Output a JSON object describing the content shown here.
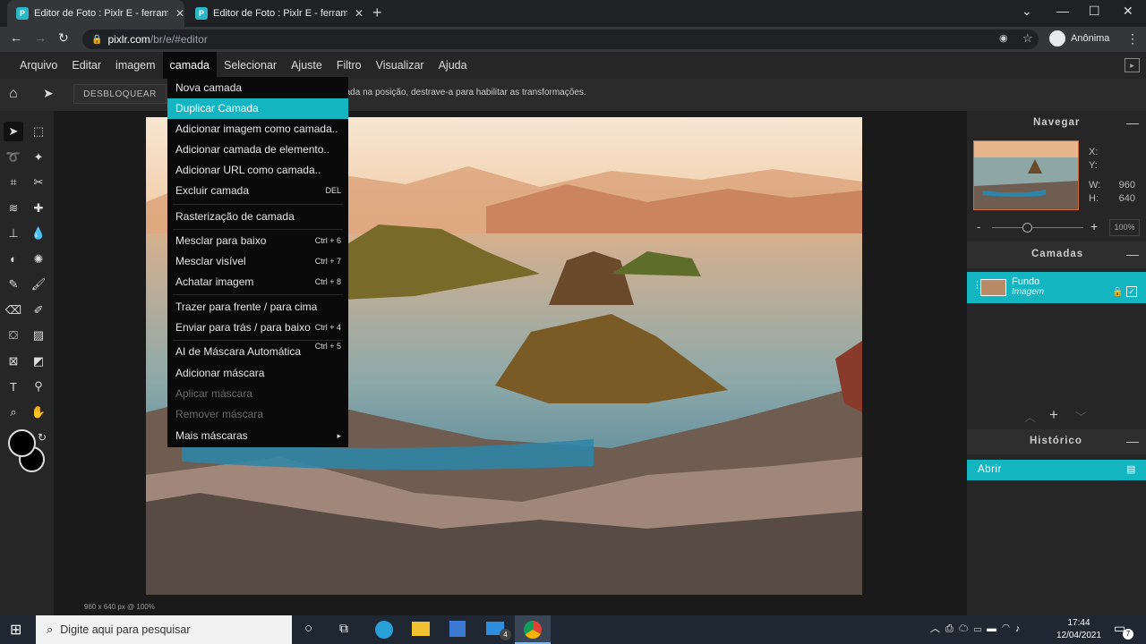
{
  "browser": {
    "tabs": [
      {
        "title": "Editor de Foto : Pixlr E - ferramen",
        "active": true
      },
      {
        "title": "Editor de Foto : Pixlr E - ferramen",
        "active": false
      }
    ],
    "url_host": "pixlr.com",
    "url_path": "/br/e/#editor",
    "profile_label": "Anônima"
  },
  "menubar": {
    "items": [
      "Arquivo",
      "Editar",
      "imagem",
      "camada",
      "Selecionar",
      "Ajuste",
      "Filtro",
      "Visualizar",
      "Ajuda"
    ],
    "active": "camada"
  },
  "toolbar": {
    "unlock_label": "DESBLOQUEAR",
    "info_text": "A camada está travada na posição, destrave-a para habilitar as transformações."
  },
  "dropdown": {
    "items": [
      {
        "label": "Nova camada",
        "shortcut": ""
      },
      {
        "label": "Duplicar Camada",
        "shortcut": "",
        "highlighted": true
      },
      {
        "label": "Adicionar imagem como camada..",
        "shortcut": ""
      },
      {
        "label": "Adicionar camada de elemento..",
        "shortcut": ""
      },
      {
        "label": "Adicionar URL como camada..",
        "shortcut": ""
      },
      {
        "label": "Excluir camada",
        "shortcut": "DEL"
      },
      {
        "label": "Rasterização de camada",
        "shortcut": ""
      },
      {
        "label": "Mesclar para baixo",
        "shortcut": "Ctrl + 6"
      },
      {
        "label": "Mesclar visível",
        "shortcut": "Ctrl + 7"
      },
      {
        "label": "Achatar imagem",
        "shortcut": "Ctrl + 8"
      },
      {
        "label": "Trazer para frente / para cima",
        "shortcut": ""
      },
      {
        "label": "Enviar para trás / para baixo",
        "shortcut": "Ctrl + 4"
      },
      {
        "label": "AI de Máscara Automática",
        "shortcut": "Ctrl + 5"
      },
      {
        "label": "Adicionar máscara",
        "shortcut": ""
      },
      {
        "label": "Aplicar máscara",
        "shortcut": "",
        "disabled": true
      },
      {
        "label": "Remover máscara",
        "shortcut": "",
        "disabled": true
      },
      {
        "label": "Mais máscaras",
        "shortcut": "▸"
      }
    ]
  },
  "navigator": {
    "title": "Navegar",
    "x_label": "X:",
    "y_label": "Y:",
    "w_label": "W:",
    "w_value": "960",
    "h_label": "H:",
    "h_value": "640",
    "zoom": "100%"
  },
  "layers": {
    "title": "Camadas",
    "items": [
      {
        "name": "Fundo",
        "type": "Imagem"
      }
    ]
  },
  "history": {
    "title": "Histórico",
    "items": [
      "Abrir"
    ]
  },
  "canvas": {
    "status": "960 x 640 px @ 100%"
  },
  "taskbar": {
    "search_placeholder": "Digite aqui para pesquisar",
    "time": "17:44",
    "date": "12/04/2021",
    "mail_badge": "4",
    "notif_badge": "7"
  },
  "colors": {
    "accent": "#13b5c1",
    "primary_color": "#000000",
    "secondary_color": "#000000"
  }
}
